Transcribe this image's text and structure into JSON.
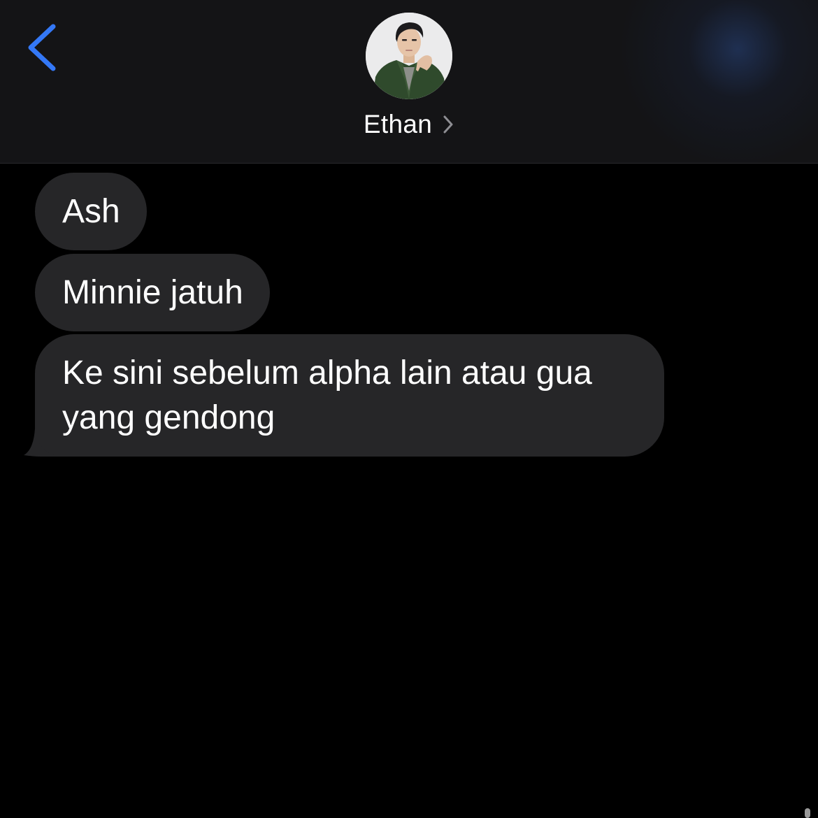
{
  "header": {
    "back_icon": "chevron-left-icon",
    "contact_name": "Ethan",
    "name_chevron_icon": "chevron-right-icon",
    "avatar_icon": "contact-photo",
    "accent_color": "#3478f6"
  },
  "messages": [
    {
      "text": "Ash"
    },
    {
      "text": "Minnie jatuh"
    },
    {
      "text": "Ke sini sebelum alpha lain atau gua yang gendong"
    }
  ],
  "colors": {
    "background": "#000000",
    "header_background": "#141416",
    "bubble_incoming": "#262628",
    "text": "#ffffff"
  }
}
